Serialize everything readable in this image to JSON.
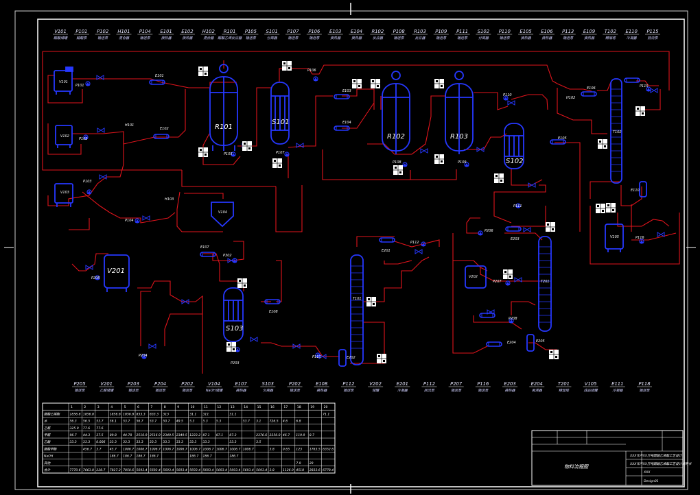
{
  "drawing_title": "物料流程图",
  "title_block": {
    "line1": "XXX年产XX万吨醋酸乙烯酯工艺设计",
    "line2": "XXX年产XX万吨醋酸乙烯酯工艺设计说明书",
    "drawn": "XXX",
    "sheet": "Design01"
  },
  "top_headers": [
    {
      "tag": "V101",
      "sub": "醋酸储罐"
    },
    {
      "tag": "P101",
      "sub": "醋酸泵"
    },
    {
      "tag": "P102",
      "sub": "输送泵"
    },
    {
      "tag": "H101",
      "sub": "混合器"
    },
    {
      "tag": "P104",
      "sub": "输送泵"
    },
    {
      "tag": "E101",
      "sub": "换热器"
    },
    {
      "tag": "E102",
      "sub": "换热器"
    },
    {
      "tag": "H102",
      "sub": "混合器"
    },
    {
      "tag": "R101",
      "sub": "醋酸乙烯反应器"
    },
    {
      "tag": "P105",
      "sub": "输送泵"
    },
    {
      "tag": "S101",
      "sub": "分离器"
    },
    {
      "tag": "P107",
      "sub": "输送泵"
    },
    {
      "tag": "P106",
      "sub": "输送泵"
    },
    {
      "tag": "E103",
      "sub": "换热器"
    },
    {
      "tag": "E104",
      "sub": "换热器"
    },
    {
      "tag": "R102",
      "sub": "反应器"
    },
    {
      "tag": "P108",
      "sub": "输送泵"
    },
    {
      "tag": "R103",
      "sub": "反应器"
    },
    {
      "tag": "P109",
      "sub": "输送泵"
    },
    {
      "tag": "P111",
      "sub": "输送泵"
    },
    {
      "tag": "S102",
      "sub": "分离器"
    },
    {
      "tag": "P110",
      "sub": "输送泵"
    },
    {
      "tag": "E105",
      "sub": "换热器"
    },
    {
      "tag": "E106",
      "sub": "换热器"
    },
    {
      "tag": "P113",
      "sub": "输送泵"
    },
    {
      "tag": "E109",
      "sub": "换热器"
    },
    {
      "tag": "T102",
      "sub": "精馏塔"
    },
    {
      "tag": "E110",
      "sub": "冷凝器"
    },
    {
      "tag": "P115",
      "sub": "回流泵"
    }
  ],
  "bottom_headers": [
    {
      "tag": "P205",
      "sub": "输送泵"
    },
    {
      "tag": "V201",
      "sub": "乙醛储罐"
    },
    {
      "tag": "P203",
      "sub": "输送泵"
    },
    {
      "tag": "P204",
      "sub": "输送泵"
    },
    {
      "tag": "P202",
      "sub": "输送泵"
    },
    {
      "tag": "V104",
      "sub": "NaOH储罐"
    },
    {
      "tag": "E107",
      "sub": "换热器"
    },
    {
      "tag": "S103",
      "sub": "分离器"
    },
    {
      "tag": "P202",
      "sub": "输送泵"
    },
    {
      "tag": "E108",
      "sub": "换热器"
    },
    {
      "tag": "P112",
      "sub": "输送泵"
    },
    {
      "tag": "V202",
      "sub": "储罐"
    },
    {
      "tag": "E201",
      "sub": "冷凝器"
    },
    {
      "tag": "P112",
      "sub": "回流泵"
    },
    {
      "tag": "P207",
      "sub": "输送泵"
    },
    {
      "tag": "P116",
      "sub": "输送泵"
    },
    {
      "tag": "E203",
      "sub": "换热器"
    },
    {
      "tag": "E204",
      "sub": "再沸器"
    },
    {
      "tag": "T201",
      "sub": "精馏塔"
    },
    {
      "tag": "V105",
      "sub": "成品储罐"
    },
    {
      "tag": "E111",
      "sub": "冷凝器"
    },
    {
      "tag": "P118",
      "sub": "输送泵"
    }
  ],
  "equipment_labels": {
    "V101": "V101",
    "P101": "P101",
    "E101": "E101",
    "V102": "V102",
    "P102": "P102",
    "H101": "H101",
    "E102": "E102",
    "V103": "V103",
    "P103": "P103",
    "P104": "P104",
    "R101": "R101",
    "P105": "P105",
    "S101": "S101",
    "P107": "P107",
    "P106": "P106",
    "E103": "E103",
    "E104": "E104",
    "R102": "R102",
    "P108": "P108",
    "R103": "R103",
    "P109": "P109",
    "P110": "P110",
    "S102": "S102",
    "P111": "P111",
    "E105": "E105",
    "H102": "H102",
    "E106": "E106",
    "T102": "T102",
    "P115": "P115",
    "E110": "E110",
    "V105": "V105",
    "P116": "P116",
    "V104": "V104",
    "H103": "H103",
    "V201": "V201",
    "P205": "P205",
    "P204": "P204",
    "E107": "E107",
    "P302": "P302",
    "S103": "S103",
    "E108": "E108",
    "P203": "P203",
    "P113": "P113",
    "E201": "E201",
    "T101": "T101",
    "P112": "P112",
    "E202": "E202",
    "E203": "E203",
    "T201": "T201",
    "P206": "P206",
    "V202": "V202",
    "P207": "P207",
    "P208": "P208",
    "E204": "E204",
    "E205": "E205"
  },
  "stream_table": {
    "columns": [
      "1",
      "2",
      "3",
      "4",
      "5",
      "6",
      "7",
      "8",
      "9",
      "10",
      "11",
      "12",
      "13",
      "14",
      "15",
      "16",
      "17",
      "18",
      "19",
      "20"
    ],
    "rows": [
      {
        "label": "醋酸乙烯酯",
        "values": [
          "1856.8",
          "1856.8",
          "",
          "1856.8",
          "1856.8",
          "833.3",
          "833.3",
          "313",
          "",
          "31.1",
          "311",
          "",
          "31.1",
          "",
          "",
          "",
          "",
          "",
          "",
          "71.1"
        ]
      },
      {
        "label": "水",
        "values": [
          "56.3",
          "56.5",
          "53.7",
          "56.1",
          "53.7",
          "56.7",
          "53.7",
          "50.7",
          "49.5",
          "5.3",
          "5.3",
          "5.3",
          "",
          "53.7",
          "3.1",
          "726.5",
          "4.6",
          "6.8",
          "",
          ""
        ]
      },
      {
        "label": "乙醛",
        "values": [
          "325.0",
          "77.6",
          "77.6",
          "",
          "",
          "",
          "",
          "",
          "",
          "",
          "",
          "",
          "",
          "",
          "",
          "",
          "",
          "",
          "",
          ""
        ]
      },
      {
        "label": "甲醛",
        "values": [
          "96.7",
          "44.3",
          "37.5",
          "89.8",
          "44.78",
          "2516.9",
          "2516.9",
          "2349.5",
          "2349.5",
          "1223.2",
          "87.1",
          "87.1",
          "87.2",
          "",
          "2376.6",
          "2356.0",
          "46.7",
          "119.9",
          "8.7",
          ""
        ]
      },
      {
        "label": "乙酸",
        "values": [
          "33.3",
          "33.3",
          "0.006",
          "33.3",
          "33.3",
          "33.3",
          "33.3",
          "33.3",
          "33.3",
          "33.3",
          "33.3",
          "",
          "33.3",
          "",
          "3.5",
          "",
          "",
          "",
          "",
          ""
        ]
      },
      {
        "label": "醋酸甲酯",
        "values": [
          "",
          "456.7",
          "3.7",
          "45.7",
          "1006.7",
          "1006.7",
          "1006.7",
          "1006.7",
          "1006.7",
          "1006.7",
          "1006.7",
          "1006.7",
          "1006.7",
          "1006.7",
          "",
          "3.8",
          "0.65",
          "123",
          "1763.5",
          "6352.6"
        ]
      },
      {
        "label": "NaOH",
        "values": [
          "",
          "",
          "",
          "186.7",
          "186.7",
          "186.7",
          "186.7",
          "",
          "",
          "186.7",
          "186.7",
          "",
          "186.7",
          "",
          "",
          "",
          "",
          "",
          "",
          ""
        ]
      },
      {
        "label": "其他",
        "values": [
          "",
          "",
          "",
          "",
          "",
          "",
          "",
          "",
          "",
          "",
          "",
          "",
          "",
          "",
          "",
          "",
          "",
          "7.9",
          "29",
          ""
        ]
      },
      {
        "label": "合计",
        "values": [
          "7770.6",
          "7663.8",
          "228.7",
          "7827.2",
          "7850.6",
          "5693.4",
          "5693.4",
          "5693.4",
          "5693.4",
          "5693.4",
          "5693.4",
          "5693.4",
          "5693.4",
          "5693.4",
          "5693.4",
          "3.8",
          "1126.9",
          "4518",
          "2833.6",
          "6778.4"
        ]
      }
    ]
  },
  "colors": {
    "background": "#000000",
    "pipe": "#e2141c",
    "equipment": "#2638ff",
    "frame": "#ffffff",
    "text": "#ffffff"
  }
}
